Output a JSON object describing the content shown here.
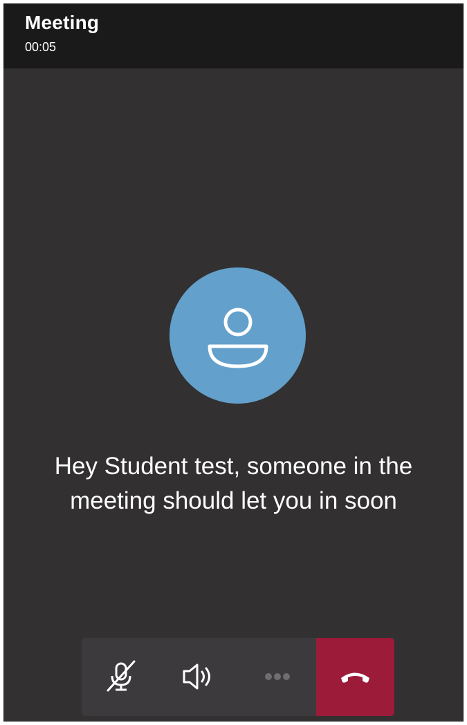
{
  "header": {
    "title": "Meeting",
    "timer": "00:05"
  },
  "lobby": {
    "message_line1": "Hey Student test, someone in the",
    "message_line2": "meeting should let you in soon",
    "avatar_icon": "person-icon"
  },
  "controls": {
    "mute_icon": "microphone-muted-icon",
    "speaker_icon": "speaker-icon",
    "more_icon": "more-options-icon",
    "hangup_icon": "hang-up-icon"
  },
  "colors": {
    "header_bg": "#1b1a1a",
    "stage_bg": "#323031",
    "avatar_bg": "#63a0cb",
    "controls_bg": "#3c3a3c",
    "hangup_bg": "#9b1b39"
  }
}
